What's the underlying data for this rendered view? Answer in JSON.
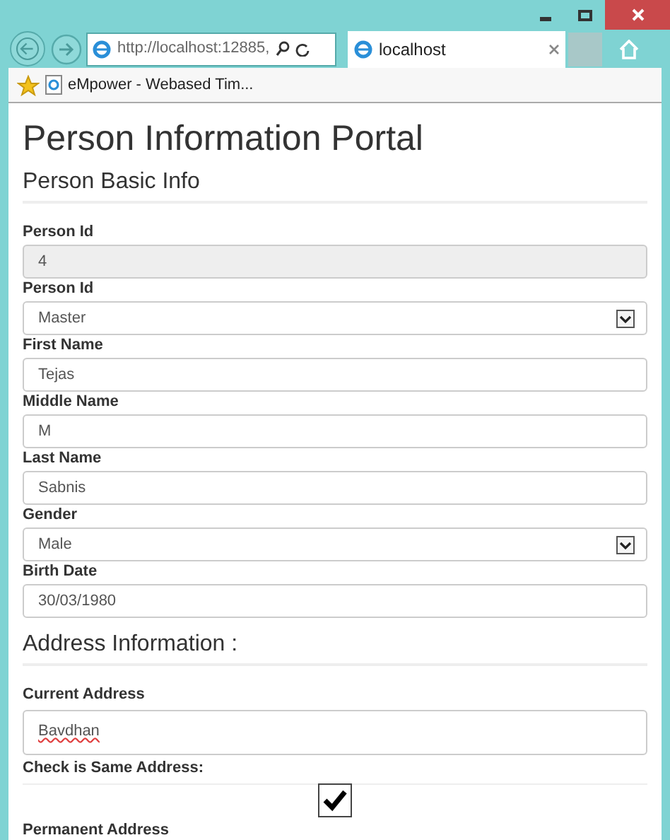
{
  "browser": {
    "address": "http://localhost:12885,",
    "tab": {
      "label": "localhost",
      "selected": true
    },
    "favorite": "eMpower - Webased Tim..."
  },
  "page": {
    "title": "Person Information Portal",
    "sections": [
      {
        "heading": "Person Basic Info",
        "fields": [
          {
            "kind": "readonly",
            "label": "Person Id",
            "value": "4"
          },
          {
            "kind": "select",
            "label": "Person Id",
            "value": "Master"
          },
          {
            "kind": "text",
            "label": "First Name",
            "value": "Tejas"
          },
          {
            "kind": "text",
            "label": "Middle Name",
            "value": "M"
          },
          {
            "kind": "text",
            "label": "Last Name",
            "value": "Sabnis"
          },
          {
            "kind": "select",
            "label": "Gender",
            "value": "Male"
          },
          {
            "kind": "text",
            "label": "Birth Date",
            "value": "30/03/1980"
          }
        ]
      },
      {
        "heading": "Address Information :",
        "fields": [
          {
            "kind": "textarea",
            "label": "Current Address",
            "value": "Bavdhan"
          },
          {
            "kind": "checkbox",
            "label": "Check is Same Address:",
            "checked": true
          },
          {
            "kind": "label",
            "label": "Permanent Address"
          }
        ]
      }
    ]
  }
}
